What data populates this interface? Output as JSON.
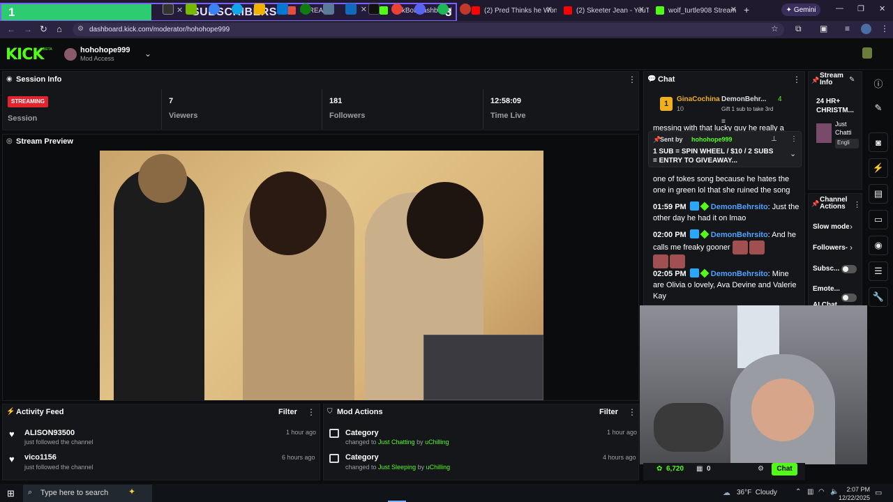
{
  "browser": {
    "tabs": [
      {
        "title": "STREAM",
        "color": "#e74c3c"
      },
      {
        "title": "KickBot Dashboard",
        "color": "#53fc18"
      },
      {
        "title": "(2) Pred Thinks he Won",
        "color": "#ff0000"
      },
      {
        "title": "(2) Skeeter Jean - YouTu",
        "color": "#ff0000"
      },
      {
        "title": "wolf_turtle908 Stream",
        "color": "#53fc18"
      }
    ],
    "overlay": {
      "start": "1",
      "label": "SUBSCRIBERS",
      "goal": "3",
      "progress": 0.33
    },
    "gemini": "Gemini",
    "url": "dashboard.kick.com/moderator/hohohope999"
  },
  "header": {
    "logo": "KICK",
    "logo_tag": "BETA",
    "channel": "hohohope999",
    "access": "Mod Access"
  },
  "session": {
    "title": "Session Info",
    "status": "STREAMING",
    "status_label": "Session",
    "stats": [
      {
        "value": "7",
        "label": "Viewers"
      },
      {
        "value": "181",
        "label": "Followers"
      },
      {
        "value": "12:58:09",
        "label": "Time Live"
      }
    ]
  },
  "preview": {
    "title": "Stream Preview"
  },
  "activity": {
    "title": "Activity Feed",
    "filter": "Filter",
    "items": [
      {
        "name": "ALISON93500",
        "desc": "just followed the channel",
        "time": "1 hour ago"
      },
      {
        "name": "vico1156",
        "desc": "just followed the channel",
        "time": "6 hours ago"
      }
    ]
  },
  "modactions": {
    "title": "Mod Actions",
    "filter": "Filter",
    "items": [
      {
        "name": "Category",
        "pre": "changed to ",
        "what": "Just Chatting",
        "by": " by ",
        "who": "uChilling",
        "time": "1 hour ago"
      },
      {
        "name": "Category",
        "pre": "changed to ",
        "what": "Just Sleeping",
        "by": " by ",
        "who": "uChilling",
        "time": "4 hours ago"
      }
    ]
  },
  "chat": {
    "title": "Chat",
    "top_gifter": {
      "rank": "1",
      "name": "GinaCochina",
      "count": "10"
    },
    "second": {
      "name": "DemonBehr...",
      "count": "4"
    },
    "gift_hint": "Gift 1 sub to take 3rd",
    "partial_top": "messing with that lucky guy he really a",
    "pinned": {
      "sent_by": "Sent by",
      "user": "hohohope999",
      "text": "1 SUB = SPIN WHEEL / $10 / 2 SUBS = ENTRY TO GIVEAWAY..."
    },
    "msg0_tail": "one of tokes song because he hates the one in green lol that she ruined the song",
    "messages": [
      {
        "time": "01:59 PM",
        "user": "DemonBehrsito",
        "text": ": Just the other day he had it on lmao"
      },
      {
        "time": "02:00 PM",
        "user": "DemonBehrsito",
        "text": ": And he calls me freaky gooner"
      },
      {
        "time": "02:05 PM",
        "user": "DemonBehrsito",
        "text": ": Mine are Olivia o lovely, Ava Devine and Valerie Kay"
      }
    ],
    "points": "6,720",
    "counter": "0",
    "button": "Chat"
  },
  "streaminfo": {
    "title": "Stream Info",
    "stream_title": "24 HR+ CHRISTM...",
    "category": "Just Chatti",
    "lang": "Engli"
  },
  "channel_actions": {
    "title": "Channel Actions",
    "items": [
      "Slow mode",
      "Followers-",
      "Subsc...",
      "Emote...",
      "AI Chat"
    ]
  },
  "taskbar": {
    "search": "Type here to search",
    "weather": "36°F  Cloudy",
    "time": "2:07 PM",
    "date": "12/22/2025"
  }
}
